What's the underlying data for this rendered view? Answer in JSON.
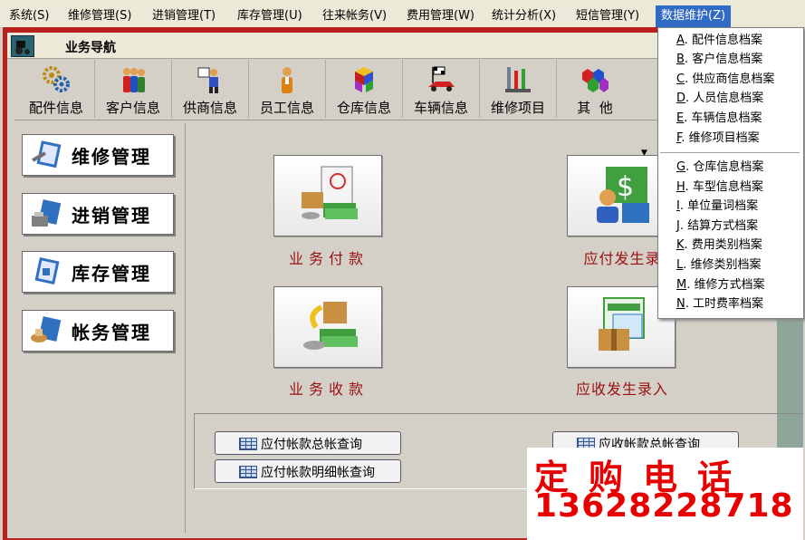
{
  "menubar": {
    "items": [
      {
        "label": "系统(S)"
      },
      {
        "label": "维修管理(S)"
      },
      {
        "label": "进销管理(T)"
      },
      {
        "label": "库存管理(U)"
      },
      {
        "label": "往来帐务(V)"
      },
      {
        "label": "费用管理(W)"
      },
      {
        "label": "统计分析(X)"
      },
      {
        "label": "短信管理(Y)"
      },
      {
        "label": "数据维护(Z)"
      }
    ]
  },
  "navbar": {
    "title": "业务导航"
  },
  "toolbar": {
    "items": [
      {
        "label": "配件信息"
      },
      {
        "label": "客户信息"
      },
      {
        "label": "供商信息"
      },
      {
        "label": "员工信息"
      },
      {
        "label": "仓库信息"
      },
      {
        "label": "车辆信息"
      },
      {
        "label": "维修项目"
      },
      {
        "label": "其  他"
      }
    ]
  },
  "leftpanel": {
    "buttons": [
      {
        "label": "维修管理"
      },
      {
        "label": "进销管理"
      },
      {
        "label": "库存管理"
      },
      {
        "label": "帐务管理"
      }
    ]
  },
  "main": {
    "tiles": [
      {
        "label": "业务付款"
      },
      {
        "label": "应付发生录"
      },
      {
        "label": "业务收款"
      },
      {
        "label": "应收发生录入"
      }
    ],
    "queries": [
      {
        "label": "应付帐款总帐查询"
      },
      {
        "label": "应付帐款明细帐查询"
      },
      {
        "label": "应收帐款总帐查询"
      }
    ]
  },
  "dropdown": {
    "items": [
      {
        "key": "A",
        "label": "配件信息档案"
      },
      {
        "key": "B",
        "label": "客户信息档案"
      },
      {
        "key": "C",
        "label": "供应商信息档案"
      },
      {
        "key": "D",
        "label": "人员信息档案"
      },
      {
        "key": "E",
        "label": "车辆信息档案"
      },
      {
        "key": "F",
        "label": "维修项目档案"
      },
      {
        "key": "G",
        "label": "仓库信息档案"
      },
      {
        "key": "H",
        "label": "车型信息档案"
      },
      {
        "key": "I",
        "label": "单位量词档案"
      },
      {
        "key": "J",
        "label": "结算方式档案"
      },
      {
        "key": "K",
        "label": "费用类别档案"
      },
      {
        "key": "L",
        "label": "维修类别档案"
      },
      {
        "key": "M",
        "label": "维修方式档案"
      },
      {
        "key": "N",
        "label": "工时费率档案"
      }
    ]
  },
  "ad": {
    "line1": "定购电话",
    "line2": "13628228718"
  },
  "colors": {
    "frame": "#b8211c",
    "menu_active": "#316ac5",
    "tile_text": "#9a1010",
    "ad_text": "#e80000"
  }
}
